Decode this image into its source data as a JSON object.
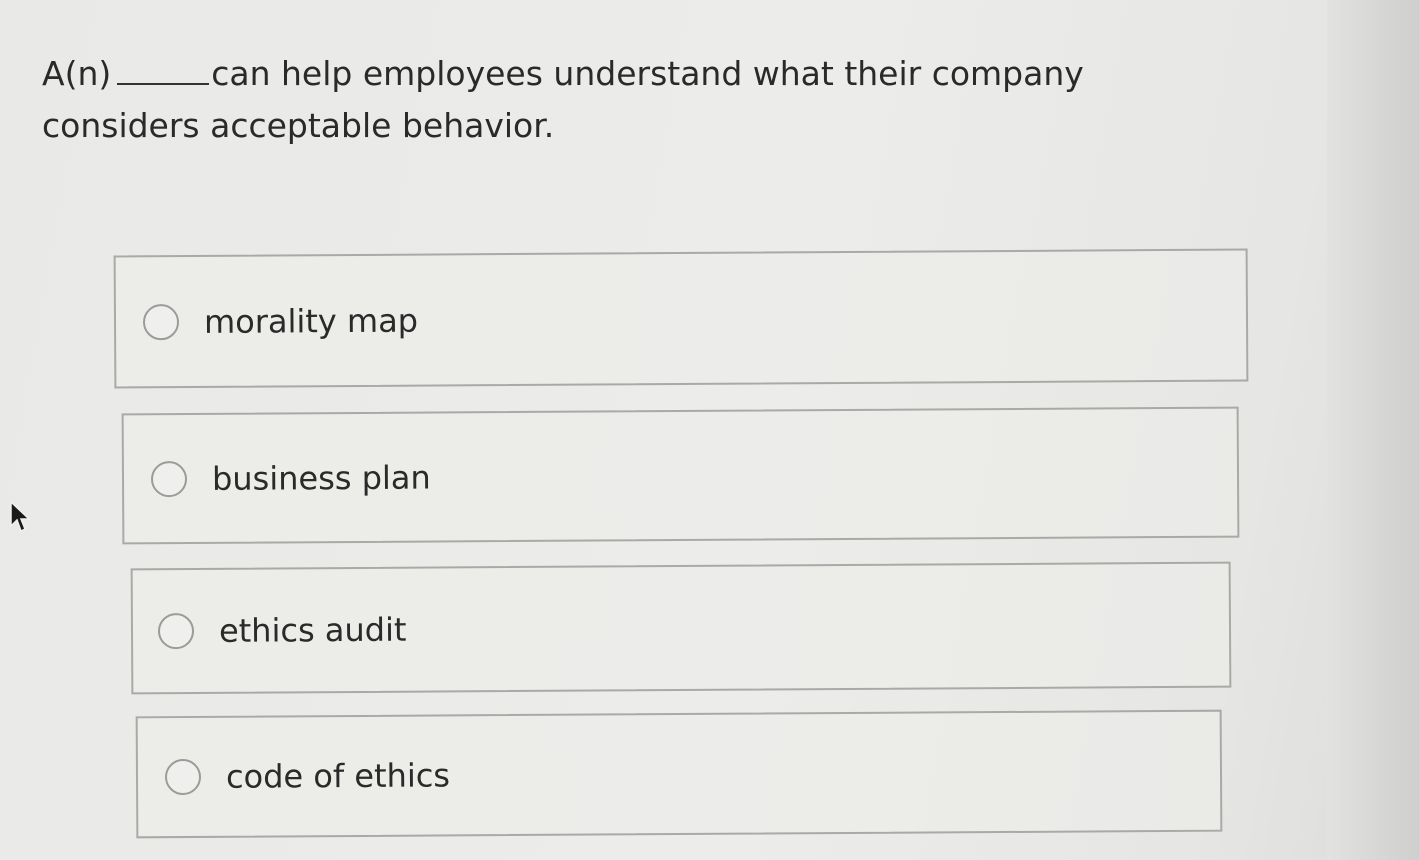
{
  "question": {
    "prefix": "A(n)",
    "text": "can help employees understand what their company considers acceptable behavior."
  },
  "options": [
    {
      "label": "morality map",
      "selected": false
    },
    {
      "label": "business plan",
      "selected": false
    },
    {
      "label": "ethics audit",
      "selected": false
    },
    {
      "label": "code of ethics",
      "selected": false
    }
  ],
  "icons": {
    "cursor": "mouse-pointer-icon",
    "radio": "radio-button-icon"
  }
}
